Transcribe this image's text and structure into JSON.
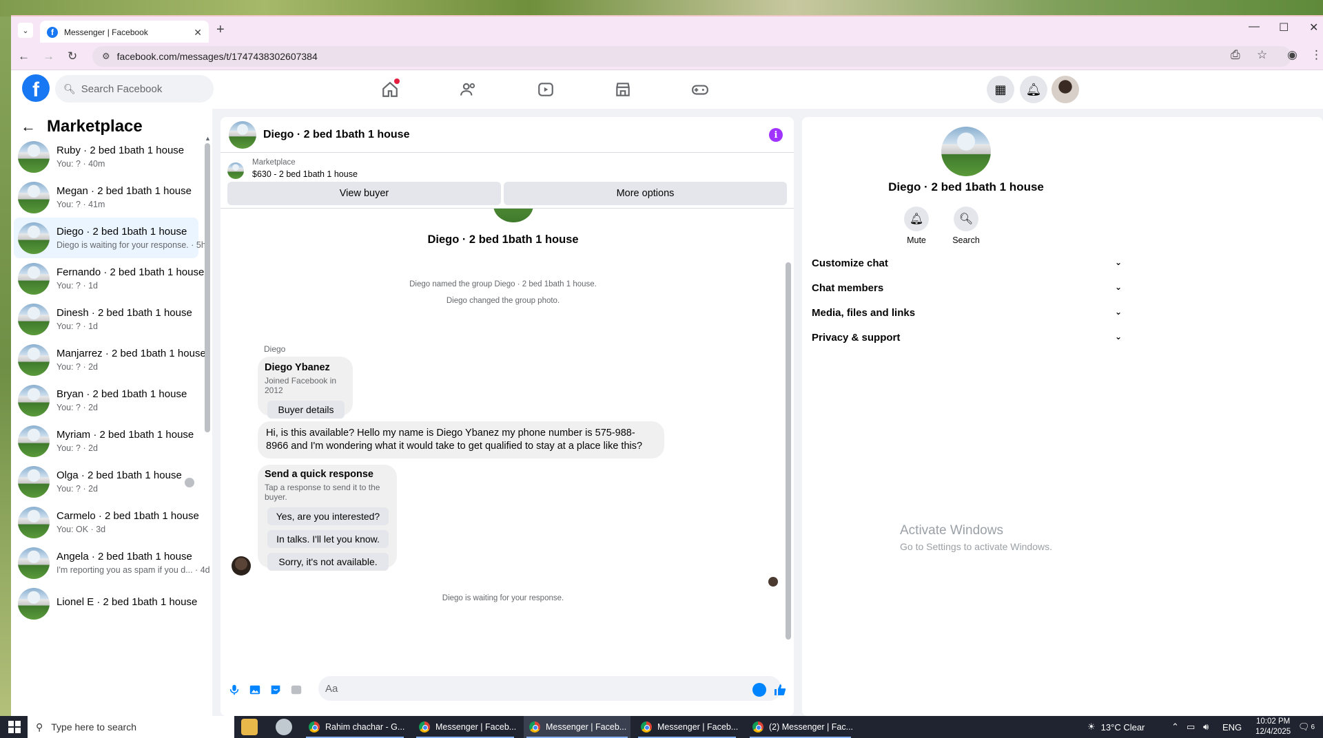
{
  "browser": {
    "tab_title": "Messenger | Facebook",
    "url": "facebook.com/messages/t/1747438302607384"
  },
  "fb": {
    "search_placeholder": "Search Facebook"
  },
  "sidebar": {
    "title": "Marketplace",
    "conversations": [
      {
        "name": "Ruby · 2 bed 1bath 1 house",
        "sub": "You: ? · 40m"
      },
      {
        "name": "Megan · 2 bed 1bath 1 house",
        "sub": "You: ? · 41m"
      },
      {
        "name": "Diego · 2 bed 1bath 1 house",
        "sub": "Diego is waiting for your response. · 5h"
      },
      {
        "name": "Fernando · 2 bed 1bath 1 house",
        "sub": "You: ? · 1d"
      },
      {
        "name": "Dinesh · 2 bed 1bath 1 house",
        "sub": "You: ? · 1d"
      },
      {
        "name": "Manjarrez · 2 bed 1bath 1 house",
        "sub": "You: ? · 2d"
      },
      {
        "name": "Bryan · 2 bed 1bath 1 house",
        "sub": "You: ? · 2d"
      },
      {
        "name": "Myriam · 2 bed 1bath 1 house",
        "sub": "You: ? · 2d"
      },
      {
        "name": "Olga · 2 bed 1bath 1 house",
        "sub": "You: ? · 2d"
      },
      {
        "name": "Carmelo · 2 bed 1bath 1 house",
        "sub": "You: OK · 3d"
      },
      {
        "name": "Angela · 2 bed 1bath 1 house",
        "sub": "I'm reporting you as spam if you d... · 4d"
      },
      {
        "name": "Lionel E · 2 bed 1bath 1 house",
        "sub": ""
      }
    ]
  },
  "chat": {
    "title": "Diego · 2 bed 1bath 1 house",
    "marketplace_label": "Marketplace",
    "listing": "$630 - 2 bed 1bath 1 house",
    "view_buyer": "View buyer",
    "more_options": "More options",
    "body_name": "Diego · 2 bed 1bath 1 house",
    "sys1": "Diego named the group Diego · 2 bed 1bath 1 house.",
    "sys2": "Diego changed the group photo.",
    "sender": "Diego",
    "buyer_name": "Diego Ybanez",
    "buyer_joined": "Joined Facebook in 2012",
    "buyer_details": "Buyer details",
    "message": "Hi, is this available? Hello my name is Diego Ybanez my phone number is 575-988-8966 and I'm wondering what it would take to get qualified to stay at a place like this?",
    "quick_title": "Send a quick response",
    "quick_sub": "Tap a response to send it to the buyer.",
    "quick1": "Yes, are you interested?",
    "quick2": "In talks. I'll let you know.",
    "quick3": "Sorry, it's not available.",
    "waiting": "Diego is waiting for your response.",
    "composer_placeholder": "Aa"
  },
  "details": {
    "name": "Diego · 2 bed 1bath 1 house",
    "mute": "Mute",
    "search": "Search",
    "sections": [
      "Customize chat",
      "Chat members",
      "Media, files and links",
      "Privacy & support"
    ]
  },
  "windows": {
    "activate_title": "Activate Windows",
    "activate_sub": "Go to Settings to activate Windows."
  },
  "taskbar": {
    "search_placeholder": "Type here to search",
    "apps": [
      "Rahim chachar - G...",
      "Messenger | Faceb...",
      "Messenger | Faceb...",
      "Messenger | Faceb...",
      "(2) Messenger | Fac..."
    ],
    "weather": "13°C  Clear",
    "lang": "ENG",
    "time": "10:02 PM",
    "date": "12/4/2025",
    "notif_count": "6"
  },
  "colors": {
    "accent": "#1877f2",
    "messenger": "#0084ff",
    "info": "#a033ff"
  }
}
